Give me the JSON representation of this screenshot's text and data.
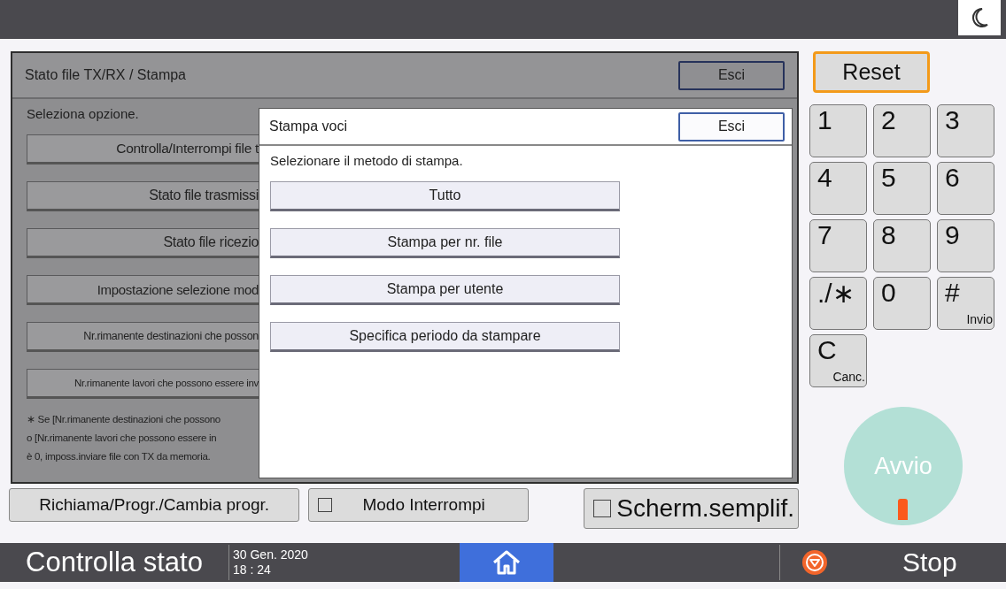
{
  "panel": {
    "title": "Stato file TX/RX / Stampa",
    "exit_button": "Esci",
    "prompt": "Seleziona opzione.",
    "options": [
      "Controlla/Interrompi file t",
      "Stato file trasmissi",
      "Stato file ricezio",
      "Impostazione selezione mod",
      "Nr.rimanente destinazioni che posson",
      "Nr.rimanente lavori che possono essere inv"
    ],
    "note_lines": [
      "∗ Se [Nr.rimanente destinazioni che possono",
      "o [Nr.rimanente lavori che possono essere in",
      "è 0, imposs.inviare file con TX da memoria."
    ]
  },
  "dialog": {
    "title": "Stampa voci",
    "exit_button": "Esci",
    "prompt": "Selezionare il metodo di stampa.",
    "options": [
      "Tutto",
      "Stampa per nr. file",
      "Stampa per utente",
      "Specifica periodo da stampare"
    ]
  },
  "bottom_buttons": [
    {
      "kind": "plain",
      "label": "Richiama/Progr./Cambia progr."
    },
    {
      "kind": "check",
      "label": "Modo Interrompi",
      "checked": false
    },
    {
      "kind": "check-large",
      "label": "Scherm.semplif.",
      "checked": false
    }
  ],
  "reset_button": "Reset",
  "keypad": [
    {
      "key": "1"
    },
    {
      "key": "2"
    },
    {
      "key": "3"
    },
    {
      "key": "4"
    },
    {
      "key": "5"
    },
    {
      "key": "6"
    },
    {
      "key": "7"
    },
    {
      "key": "8"
    },
    {
      "key": "9"
    },
    {
      "key": "./∗"
    },
    {
      "key": "0"
    },
    {
      "key": "#",
      "sub": "Invio"
    },
    {
      "key": "C",
      "sub": "Canc."
    }
  ],
  "start_button": "Avvio",
  "status_bar": {
    "check_status": "Controlla stato",
    "date": "30 Gen. 2020",
    "time": "18 : 24",
    "stop": "Stop"
  }
}
